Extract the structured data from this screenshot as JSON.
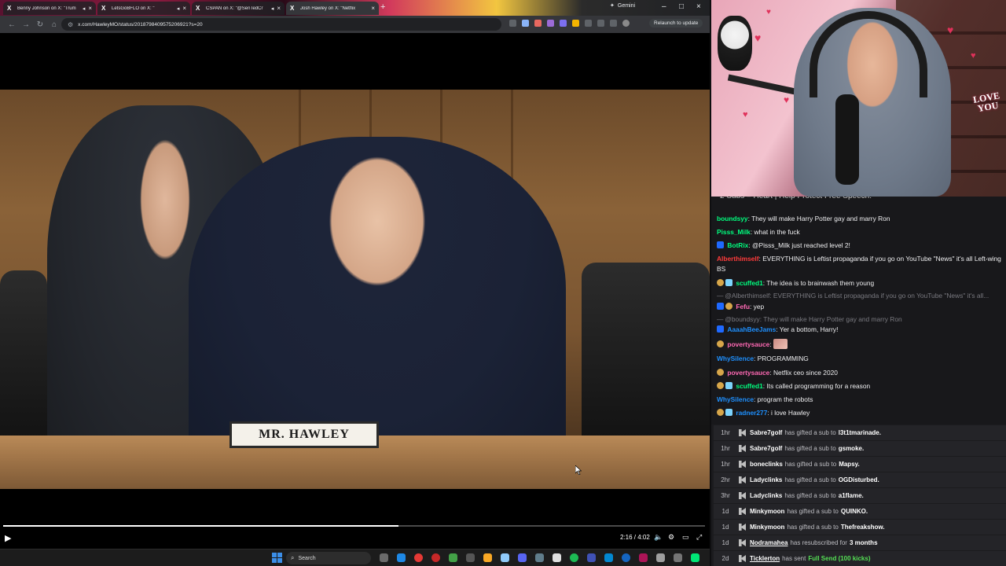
{
  "browser": {
    "tabs": [
      {
        "title": "Benny Johnson on X: \"Trum",
        "active": false,
        "muted": false
      },
      {
        "title": "LetsGoBFLO on X: \"",
        "active": false,
        "muted": true
      },
      {
        "title": "CSPAN on X: \"@SenTedCr",
        "active": false,
        "muted": true
      },
      {
        "title": "Josh Hawley on X: \"Netflix",
        "active": true,
        "muted": false
      }
    ],
    "gemini_tab": "Gemini",
    "url": "x.com/HawleyMO/status/2018798409575206921?s=20",
    "relaunch_label": "Relaunch to update"
  },
  "video": {
    "nameplate": "MR. HAWLEY",
    "time_display": "2:16 / 4:02",
    "progress": 0.563
  },
  "taskbar": {
    "search_placeholder": "Search"
  },
  "webcam": {
    "love_sign_line1": "LOVE",
    "love_sign_line2": "YOU"
  },
  "chat": {
    "header": "2 Subs = Heart | Help Protect Free Speech!",
    "messages": [
      {
        "user": "boundsyy",
        "color": "#00ff7f",
        "text": "They will make Harry Potter gay and marry Ron",
        "badges": []
      },
      {
        "user": "Pisss_Milk",
        "color": "#00ff7f",
        "text": "what in the fuck",
        "badges": []
      },
      {
        "user": "BotRix",
        "color": "#00ff7f",
        "text": "@Pisss_Milk just reached level 2!",
        "badges": [
          "mod"
        ]
      },
      {
        "user": "Alberthimself",
        "color": "#ff3b3b",
        "text": "EVERYTHING is Leftist propaganda if you go on YouTube \"News\" it's all Left-wing BS",
        "badges": []
      },
      {
        "user": "scuffed1",
        "color": "#00ff7f",
        "text": "The idea is to brainwash them young",
        "badges": [
          "cheer",
          "sub"
        ]
      },
      {
        "reply": "@Alberthimself: EVERYTHING is Leftist propaganda if you go on YouTube \"News\" it's all..."
      },
      {
        "user": "Fefu",
        "color": "#ff69b4",
        "text": "yep",
        "badges": [
          "mod",
          "cheer"
        ]
      },
      {
        "reply": "@boundsyy: They will make Harry Potter gay and marry Ron"
      },
      {
        "user": "AaaahBeeJams",
        "color": "#1e90ff",
        "text": "Yer a bottom, Harry!",
        "badges": [
          "mod"
        ]
      },
      {
        "user": "povertysauce",
        "color": "#ff69b4",
        "text": "",
        "badges": [
          "cheer"
        ],
        "emote": "face-emote"
      },
      {
        "user": "WhySilence",
        "color": "#1e90ff",
        "text": "PROGRAMMING",
        "badges": []
      },
      {
        "user": "povertysauce",
        "color": "#ff69b4",
        "text": "Netflix ceo since 2020",
        "badges": [
          "cheer"
        ]
      },
      {
        "user": "scuffed1",
        "color": "#00ff7f",
        "text": "Its called programming for a reason",
        "badges": [
          "cheer",
          "sub"
        ]
      },
      {
        "user": "WhySilence",
        "color": "#1e90ff",
        "text": "program the robots",
        "badges": []
      },
      {
        "user": "radner277",
        "color": "#1e90ff",
        "text": "i love Hawley",
        "badges": [
          "cheer",
          "sub"
        ]
      }
    ]
  },
  "events": [
    {
      "time": "1hr",
      "name": "Sabre7golf",
      "underline": false,
      "middle": "has gifted a sub to",
      "target": "l3t1tmarinade."
    },
    {
      "time": "1hr",
      "name": "Sabre7golf",
      "underline": false,
      "middle": "has gifted a sub to",
      "target": "gsmoke."
    },
    {
      "time": "1hr",
      "name": "boneclinks",
      "underline": false,
      "middle": "has gifted a sub to",
      "target": "Mapsy."
    },
    {
      "time": "2hr",
      "name": "Ladyclinks",
      "underline": false,
      "middle": "has gifted a sub to",
      "target": "OGDisturbed."
    },
    {
      "time": "3hr",
      "name": "Ladyclinks",
      "underline": false,
      "middle": "has gifted a sub to",
      "target": "a1flame."
    },
    {
      "time": "1d",
      "name": "Minkymoon",
      "underline": false,
      "middle": "has gifted a sub to",
      "target": "QUINKO."
    },
    {
      "time": "1d",
      "name": "Minkymoon",
      "underline": false,
      "middle": "has gifted a sub to",
      "target": "Thefreakshow."
    },
    {
      "time": "1d",
      "name": "Nodramahea",
      "underline": true,
      "middle": "has resubscribed for",
      "target": "3 months"
    },
    {
      "time": "2d",
      "name": "Ticklerton",
      "underline": true,
      "middle": "has sent",
      "target": "Full Send (100 kicks)",
      "green": true
    }
  ]
}
